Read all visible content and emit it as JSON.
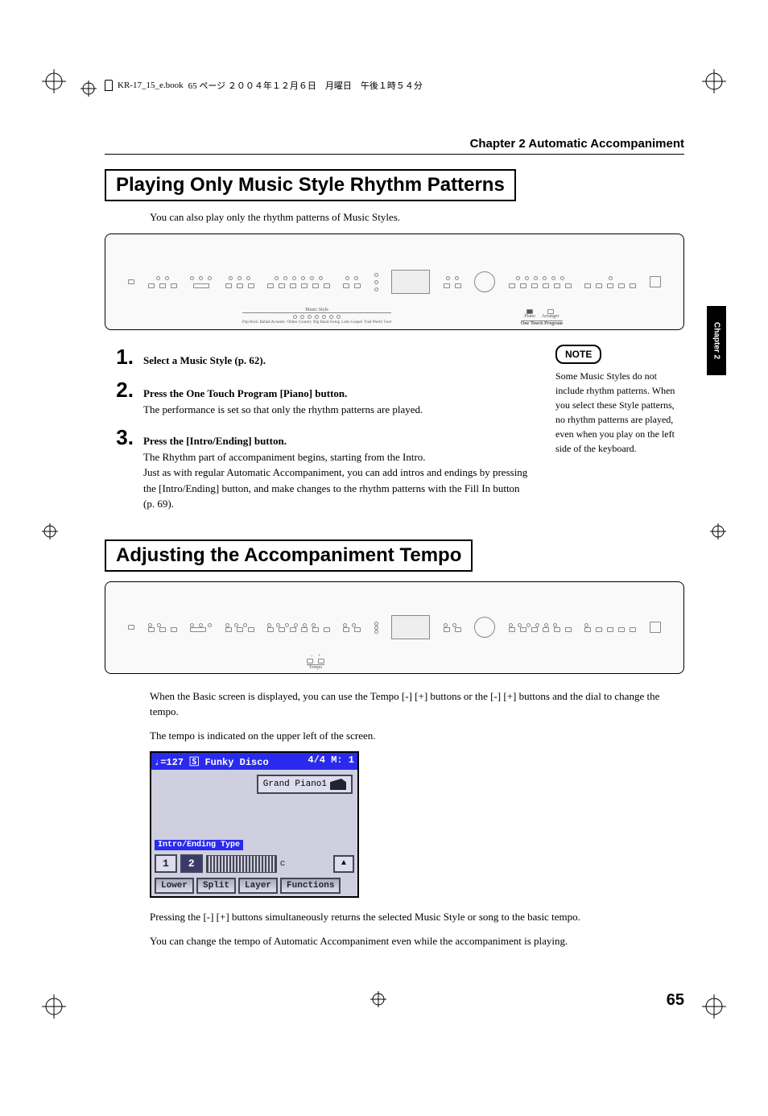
{
  "header": {
    "book_file": "KR-17_15_e.book",
    "page_info": "65 ページ ２００４年１２月６日　月曜日　午後１時５４分"
  },
  "chapter_header": "Chapter 2 Automatic Accompaniment",
  "side_tab": "Chapter 2",
  "section1": {
    "title": "Playing Only Music Style Rhythm Patterns",
    "intro": "You can also play only the rhythm patterns of Music Styles.",
    "fig": {
      "music_style_label": "Music Style",
      "otp_label": "One Touch Program",
      "otp_piano": "Piano",
      "otp_arranger": "Arranger",
      "styles": [
        "Pop Rock",
        "Ballad Acoustic",
        "Oldies Country",
        "Big Band Swing",
        "Latin Gospel",
        "Trad World",
        "User"
      ]
    },
    "steps": [
      {
        "num": "1",
        "bold": "Select a Music Style (p. 62).",
        "rest": ""
      },
      {
        "num": "2",
        "bold": "Press the One Touch Program [Piano] button.",
        "rest": "The performance is set so that only the rhythm patterns are played."
      },
      {
        "num": "3",
        "bold": "Press the [Intro/Ending] button.",
        "rest": "The Rhythm part of accompaniment begins, starting from the Intro.\nJust as with regular Automatic Accompaniment, you can add intros and endings by pressing the [Intro/Ending] button, and make changes to the rhythm patterns with the Fill In button (p. 69)."
      }
    ],
    "note": {
      "badge": "NOTE",
      "text": "Some Music Styles do not include rhythm patterns. When you select these Style patterns, no rhythm patterns are played, even when you play on the left side of the keyboard."
    }
  },
  "section2": {
    "title": "Adjusting the Accompaniment Tempo",
    "fig": {
      "tempo_label": "Tempo"
    },
    "body1": "When the Basic screen is displayed, you can use the Tempo [-] [+] buttons or the [-] [+] buttons and the dial to change the tempo.",
    "body2": "The tempo is indicated on the upper left of the screen.",
    "lcd": {
      "top_left": "♩=127",
      "top_style_icon": "🅂",
      "top_style_name": "Funky Disco",
      "top_right": "4/4  M:   1",
      "instrument": "Grand Piano1",
      "intro_label": "Intro/Ending Type",
      "chips": [
        "1",
        "2"
      ],
      "tabs": [
        "Lower",
        "Split",
        "Layer",
        "Functions"
      ]
    },
    "body3": "Pressing the [-] [+] buttons simultaneously returns the selected Music Style or song to the basic tempo.",
    "body4": "You can change the tempo of Automatic Accompaniment even while the accompaniment is playing."
  },
  "page_number": "65"
}
